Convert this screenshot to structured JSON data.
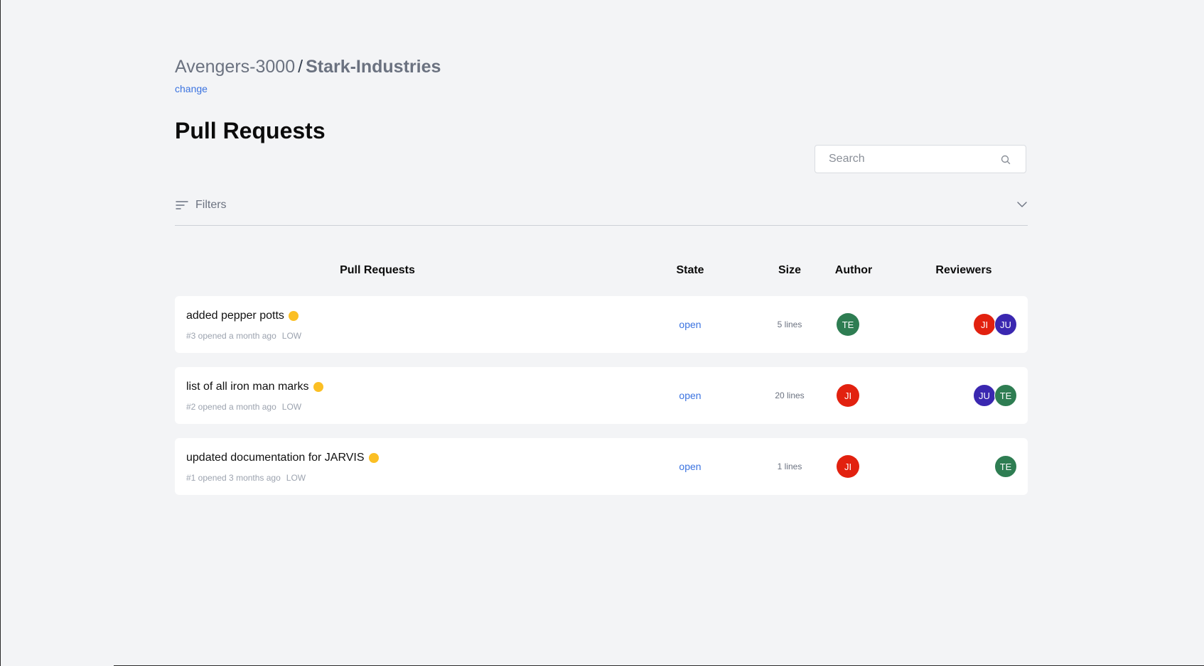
{
  "breadcrumb": {
    "org": "Avengers-3000",
    "separator": "/",
    "repo": "Stark-Industries",
    "change_label": "change"
  },
  "page": {
    "title": "Pull Requests"
  },
  "search": {
    "placeholder": "Search",
    "value": ""
  },
  "filters": {
    "label": "Filters"
  },
  "table": {
    "headers": {
      "pull_requests": "Pull Requests",
      "state": "State",
      "size": "Size",
      "author": "Author",
      "reviewers": "Reviewers"
    },
    "rows": [
      {
        "title": "added pepper potts",
        "meta": "#3 opened a month ago",
        "priority": "LOW",
        "state": "open",
        "size": "5 lines",
        "author": {
          "initials": "TE",
          "color": "#2e7d52"
        },
        "reviewers": [
          {
            "initials": "JI",
            "color": "#e2210f"
          },
          {
            "initials": "JU",
            "color": "#3a27b0"
          }
        ]
      },
      {
        "title": "list of all iron man marks",
        "meta": "#2 opened a month ago",
        "priority": "LOW",
        "state": "open",
        "size": "20 lines",
        "author": {
          "initials": "JI",
          "color": "#e2210f"
        },
        "reviewers": [
          {
            "initials": "JU",
            "color": "#3a27b0"
          },
          {
            "initials": "TE",
            "color": "#2e7d52"
          }
        ]
      },
      {
        "title": "updated documentation for JARVIS",
        "meta": "#1 opened 3 months ago",
        "priority": "LOW",
        "state": "open",
        "size": "1 lines",
        "author": {
          "initials": "JI",
          "color": "#e2210f"
        },
        "reviewers": [
          {
            "initials": "TE",
            "color": "#2e7d52"
          }
        ]
      }
    ]
  },
  "colors": {
    "background": "#f3f4f6",
    "link": "#3b73e0",
    "status_dot": "#fbbf24"
  }
}
